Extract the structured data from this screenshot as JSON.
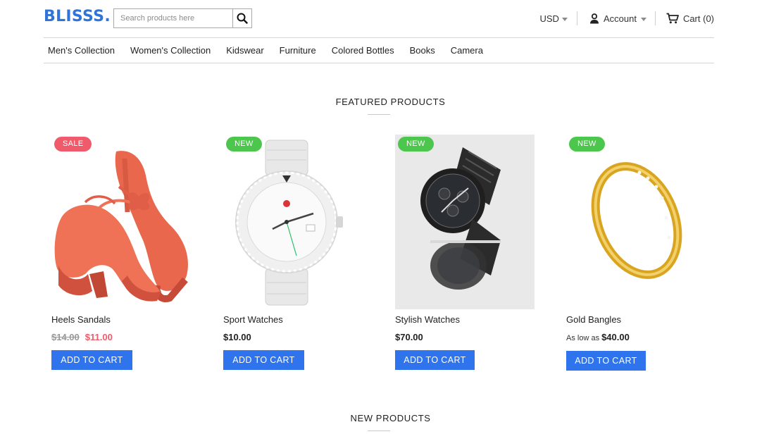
{
  "brand": {
    "name": "BLISSS",
    "dot": "."
  },
  "search": {
    "placeholder": "Search products here"
  },
  "header": {
    "currency": "USD",
    "account_label": "Account",
    "cart_label": "Cart (0)"
  },
  "nav": {
    "items": [
      {
        "label": "Men's Collection"
      },
      {
        "label": "Women's Collection"
      },
      {
        "label": "Kidswear"
      },
      {
        "label": "Furniture"
      },
      {
        "label": "Colored Bottles"
      },
      {
        "label": "Books"
      },
      {
        "label": "Camera"
      }
    ]
  },
  "featured": {
    "title": "FEATURED PRODUCTS",
    "products": [
      {
        "name": "Heels Sandals",
        "badge": "SALE",
        "old_price": "$14.00",
        "price": "$11.00",
        "button": "ADD TO CART"
      },
      {
        "name": "Sport Watches",
        "badge": "NEW",
        "price": "$10.00",
        "button": "ADD TO CART"
      },
      {
        "name": "Stylish Watches",
        "badge": "NEW",
        "price": "$70.00",
        "button": "ADD TO CART"
      },
      {
        "name": "Gold Bangles",
        "badge": "NEW",
        "price_prefix": "As low as",
        "price": "$40.00",
        "button": "ADD TO CART"
      }
    ]
  },
  "new_products": {
    "title": "NEW PRODUCTS"
  },
  "colors": {
    "brand": "#2f74d6",
    "button": "#2f74ed",
    "sale": "#ef5b6a",
    "new": "#4cc64c"
  }
}
